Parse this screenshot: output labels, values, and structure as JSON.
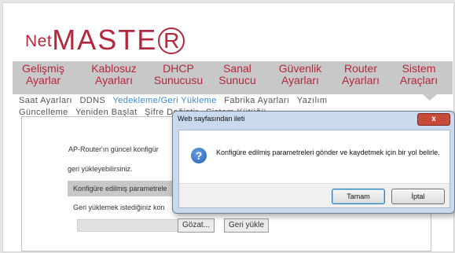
{
  "logo": {
    "net": "Net",
    "master": "MASTE",
    "r_letter": "R"
  },
  "main_nav": [
    {
      "line1": "Gelişmiş",
      "line2": "Ayarlar"
    },
    {
      "line1": "Kablosuz",
      "line2": "Ayarları"
    },
    {
      "line1": "DHCP",
      "line2": "Sunucusu"
    },
    {
      "line1": "Sanal",
      "line2": "Sunucu"
    },
    {
      "line1": "Güvenlik",
      "line2": "Ayarları"
    },
    {
      "line1": "Router",
      "line2": "Ayarları"
    },
    {
      "line1": "Sistem",
      "line2": "Araçları"
    }
  ],
  "sub_nav": [
    {
      "label": "Saat Ayarları",
      "active": false
    },
    {
      "label": "DDNS",
      "active": false
    },
    {
      "label": "Yedekleme/Geri Yükleme",
      "active": true
    },
    {
      "label": "Fabrika Ayarları",
      "active": false
    },
    {
      "label": "Yazılım Güncelleme",
      "active": false
    },
    {
      "label": "Yeniden Başlat",
      "active": false
    },
    {
      "label": "Şifre Değiştir",
      "active": false
    },
    {
      "label": "Sistem Kütüğü",
      "active": false
    }
  ],
  "content": {
    "text1": "AP-Router'ın güncel konfigür",
    "text2": "geri yükleyebilirsiniz.",
    "row_label": "Konfigüre edilmiş parametrele",
    "text3": "Geri yüklemek istediğiniz kon",
    "browse_button": "Gözat...",
    "restore_button": "Geri yükle"
  },
  "dialog": {
    "title": "Web sayfasından ileti",
    "close": "x",
    "message": "Konfigüre edilmiş parametreleri gönder ve kaydetmek için bir yol belirle.",
    "ok": "Tamam",
    "cancel": "İptal"
  },
  "colors": {
    "brand": "#b4273d",
    "active_link": "#3b8ad3",
    "nav_bg": "#c8c8c8"
  }
}
